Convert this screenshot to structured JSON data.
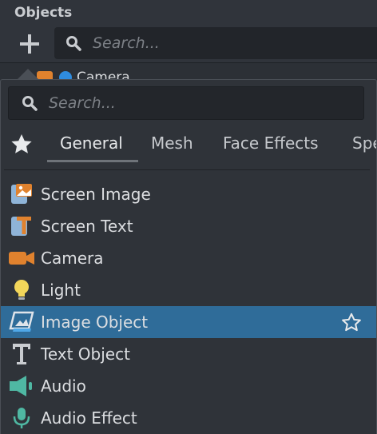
{
  "panel": {
    "title": "Objects",
    "search_placeholder": "Search...",
    "peek_item": "Camera"
  },
  "popup": {
    "search_placeholder": "Search...",
    "tabs": [
      {
        "label": "General",
        "active": true
      },
      {
        "label": "Mesh",
        "active": false
      },
      {
        "label": "Face Effects",
        "active": false
      },
      {
        "label": "Spe",
        "active": false
      }
    ],
    "items": [
      {
        "label": "Screen Image",
        "icon": "screen-image-icon",
        "selected": false
      },
      {
        "label": "Screen Text",
        "icon": "screen-text-icon",
        "selected": false
      },
      {
        "label": "Camera",
        "icon": "camera-icon",
        "selected": false
      },
      {
        "label": "Light",
        "icon": "light-bulb-icon",
        "selected": false
      },
      {
        "label": "Image Object",
        "icon": "image-object-icon",
        "selected": true
      },
      {
        "label": "Text Object",
        "icon": "text-object-icon",
        "selected": false
      },
      {
        "label": "Audio",
        "icon": "audio-speaker-icon",
        "selected": false
      },
      {
        "label": "Audio Effect",
        "icon": "microphone-icon",
        "selected": false
      }
    ]
  },
  "colors": {
    "background": "#30343b",
    "selection": "#2f6c99",
    "orange": "#e0822e",
    "teal": "#4fb8a3",
    "yellow": "#f2d65a",
    "blue": "#2f8cdf"
  }
}
